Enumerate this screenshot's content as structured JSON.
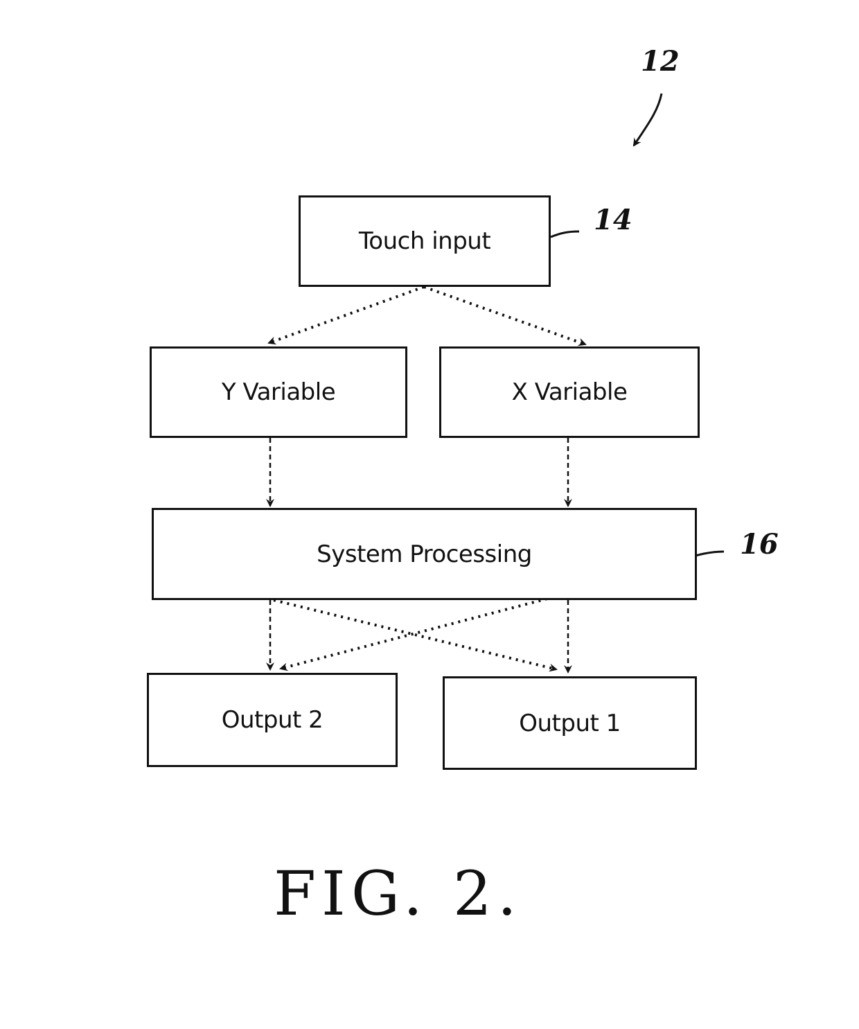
{
  "diagram": {
    "reference_numerals": {
      "figure": "12",
      "touch_input": "14",
      "system_processing": "16"
    },
    "nodes": [
      {
        "id": "touch_input",
        "label": "Touch input"
      },
      {
        "id": "y_variable",
        "label": "Y Variable"
      },
      {
        "id": "x_variable",
        "label": "X Variable"
      },
      {
        "id": "system_processing",
        "label": "System Processing"
      },
      {
        "id": "output_2",
        "label": "Output 2"
      },
      {
        "id": "output_1",
        "label": "Output 1"
      }
    ],
    "edges": [
      {
        "from": "touch_input",
        "to": "y_variable",
        "style": "dotted"
      },
      {
        "from": "touch_input",
        "to": "x_variable",
        "style": "dotted"
      },
      {
        "from": "y_variable",
        "to": "system_processing",
        "style": "dashed"
      },
      {
        "from": "x_variable",
        "to": "system_processing",
        "style": "dashed"
      },
      {
        "from": "system_processing",
        "to": "output_2",
        "style": "dashed"
      },
      {
        "from": "system_processing",
        "to": "output_1",
        "style": "dashed"
      },
      {
        "from": "system_processing",
        "to": "output_2",
        "style": "dotted-crossed"
      },
      {
        "from": "system_processing",
        "to": "output_1",
        "style": "dotted-crossed"
      }
    ],
    "caption": "FIG. 2."
  }
}
